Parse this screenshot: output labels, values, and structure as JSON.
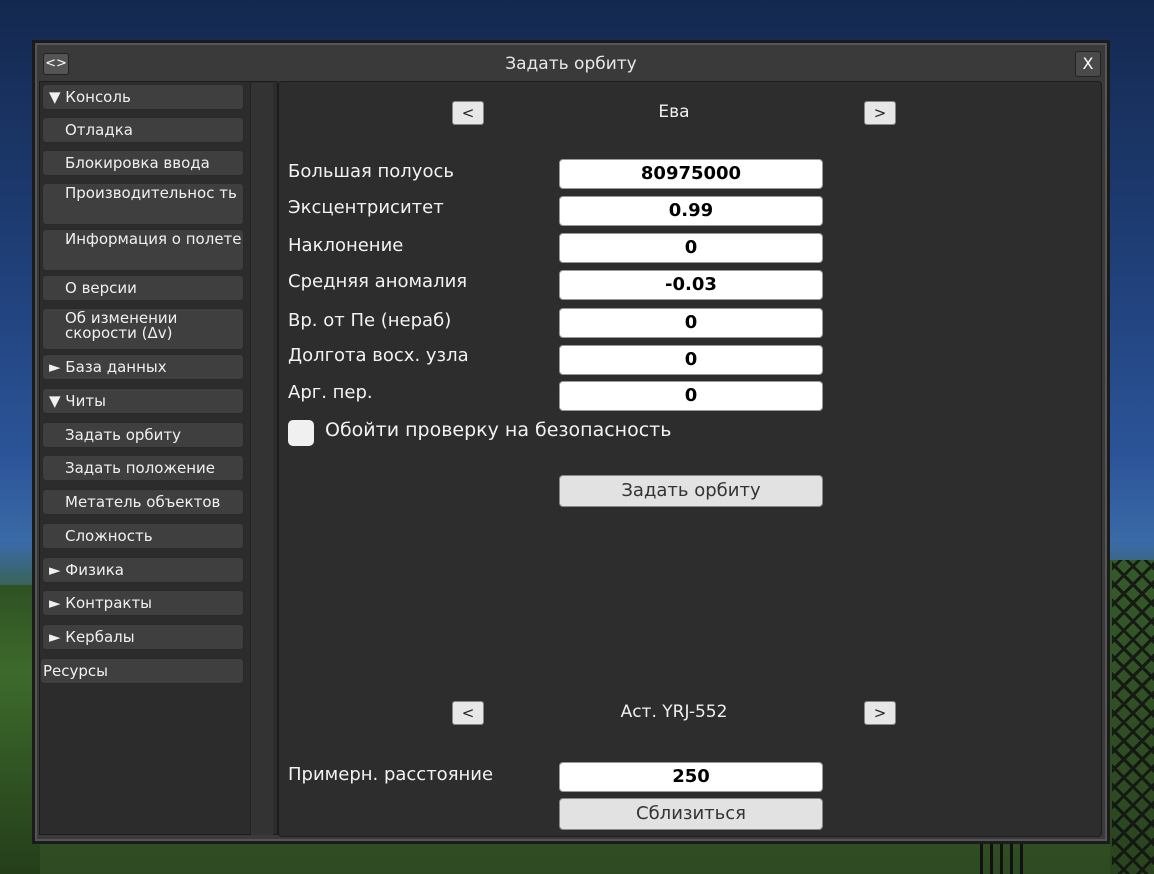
{
  "window": {
    "title": "Задать орбиту",
    "resize_label": "<>",
    "close_label": "X"
  },
  "sidebar": {
    "items": [
      {
        "label": "▼ Консоль",
        "kind": "group"
      },
      {
        "label": "Отладка",
        "kind": "child"
      },
      {
        "label": "Блокировка ввода",
        "kind": "child"
      },
      {
        "label": "Производительнос ть",
        "kind": "child"
      },
      {
        "label": "Информация о полете",
        "kind": "child"
      },
      {
        "label": "О версии",
        "kind": "child"
      },
      {
        "label": "Об изменении скорости (Δv)",
        "kind": "child"
      },
      {
        "label": "► База данных",
        "kind": "group"
      },
      {
        "label": "▼ Читы",
        "kind": "group"
      },
      {
        "label": "Задать орбиту",
        "kind": "child"
      },
      {
        "label": "Задать положение",
        "kind": "child"
      },
      {
        "label": "Метатель объектов",
        "kind": "child"
      },
      {
        "label": "Сложность",
        "kind": "child"
      },
      {
        "label": "► Физика",
        "kind": "group"
      },
      {
        "label": "► Контракты",
        "kind": "group"
      },
      {
        "label": "► Кербалы",
        "kind": "group"
      },
      {
        "label": "Ресурсы",
        "kind": "plain"
      }
    ]
  },
  "orbit": {
    "prev_label": "<",
    "next_label": ">",
    "body_name": "Ева",
    "fields": [
      {
        "label": "Большая полуось",
        "value": "80975000"
      },
      {
        "label": "Эксцентриситет",
        "value": "0.99"
      },
      {
        "label": "Наклонение",
        "value": "0"
      },
      {
        "label": "Средняя аномалия",
        "value": "-0.03"
      },
      {
        "label": "Вр. от Пе (нераб)",
        "value": "0"
      },
      {
        "label": "Долгота восх. узла",
        "value": "0"
      },
      {
        "label": "Арг. пер.",
        "value": "0"
      }
    ],
    "bypass_checkbox_label": "Обойти проверку на безопасность",
    "bypass_checked": false,
    "submit_label": "Задать орбиту"
  },
  "rendezvous": {
    "prev_label": "<",
    "next_label": ">",
    "target_name": "Аст. YRJ-552",
    "distance_label": "Примерн. расстояние",
    "distance_value": "250",
    "submit_label": "Сблизиться"
  }
}
